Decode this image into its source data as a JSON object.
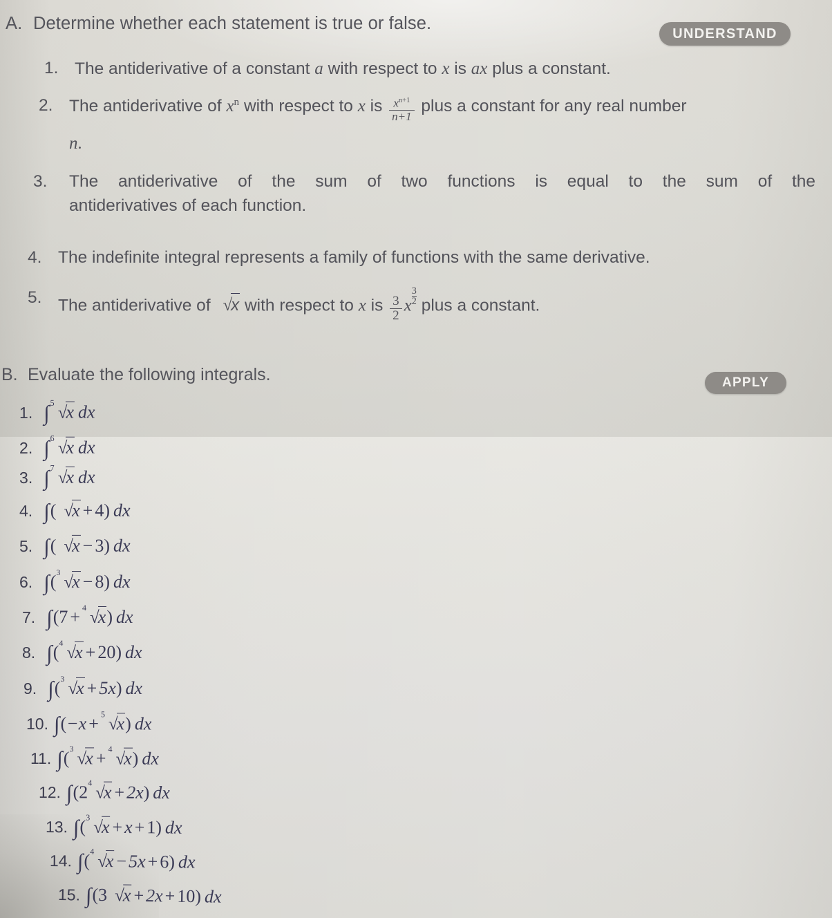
{
  "section_a": {
    "label": "A.",
    "title": "Determine whether each statement is true or false.",
    "badge": "UNDERSTAND",
    "badge_color": "#8e8b87",
    "items": [
      {
        "number": "1.",
        "text_parts": {
          "p1": "The antiderivative of a constant ",
          "var1": "a",
          "p2": " with respect to ",
          "var2": "x",
          "p3": " is ",
          "var3": "ax",
          "p4": " plus a constant."
        },
        "plain": "The antiderivative of a constant a with respect to x is ax plus a constant."
      },
      {
        "number": "2.",
        "text_parts": {
          "p1": "The antiderivative of ",
          "var1": "x",
          "exp1": "n",
          "p2": " with respect to ",
          "var2": "x",
          "p3": " is ",
          "frac_num": "x",
          "frac_num_exp": "n+1",
          "frac_den": "n+1",
          "p4": " plus a constant for any real number",
          "p5": "n",
          "p6": "."
        },
        "plain": "The antiderivative of x^n with respect to x is x^(n+1)/(n+1) plus a constant for any real number n."
      },
      {
        "number": "3.",
        "text_parts": {
          "p1": "The antiderivative of the sum of two functions is equal to the sum of the",
          "p2": "antiderivatives of each function."
        },
        "plain": "The antiderivative of the sum of two functions is equal to the sum of the antiderivatives of each function."
      },
      {
        "number": "4.",
        "text_parts": {
          "p1": "The indefinite integral represents a family of functions with the same derivative."
        },
        "plain": "The indefinite integral represents a family of functions with the same derivative."
      },
      {
        "number": "5.",
        "text_parts": {
          "p1": "The antiderivative of ",
          "rad": "x",
          "p2": " with respect to ",
          "var2": "x",
          "p3": " is ",
          "coef_num": "3",
          "coef_den": "2",
          "basevar": "x",
          "exp_num": "3",
          "exp_den": "2",
          "p4": " plus a constant."
        },
        "plain": "The antiderivative of sqrt(x) with respect to x is (3/2)x^(3/2) plus a constant."
      }
    ]
  },
  "section_b": {
    "label": "B.",
    "title": "Evaluate the following integrals.",
    "badge": "APPLY",
    "badge_color": "#8e8b87",
    "items": [
      {
        "number": "1.",
        "expr": "∫ ⁵√x dx",
        "terms": [
          {
            "type": "radical",
            "index": "5",
            "radicand": "x"
          }
        ]
      },
      {
        "number": "2.",
        "expr": "∫ ⁶√x dx",
        "terms": [
          {
            "type": "radical",
            "index": "6",
            "radicand": "x"
          }
        ]
      },
      {
        "number": "3.",
        "expr": "∫ ⁷√x dx",
        "terms": [
          {
            "type": "radical",
            "index": "7",
            "radicand": "x"
          }
        ]
      },
      {
        "number": "4.",
        "expr": "∫(√x + 4) dx",
        "terms": [
          {
            "type": "radical",
            "index": "",
            "radicand": "x"
          },
          {
            "type": "op",
            "value": "+"
          },
          {
            "type": "const",
            "value": "4"
          }
        ]
      },
      {
        "number": "5.",
        "expr": "∫(√x − 3) dx",
        "terms": [
          {
            "type": "radical",
            "index": "",
            "radicand": "x"
          },
          {
            "type": "op",
            "value": "−"
          },
          {
            "type": "const",
            "value": "3"
          }
        ]
      },
      {
        "number": "6.",
        "expr": "∫(³√x − 8) dx",
        "terms": [
          {
            "type": "radical",
            "index": "3",
            "radicand": "x"
          },
          {
            "type": "op",
            "value": "−"
          },
          {
            "type": "const",
            "value": "8"
          }
        ]
      },
      {
        "number": "7.",
        "expr": "∫(7 + ⁴√x) dx",
        "terms": [
          {
            "type": "const",
            "value": "7"
          },
          {
            "type": "op",
            "value": "+"
          },
          {
            "type": "radical",
            "index": "4",
            "radicand": "x"
          }
        ]
      },
      {
        "number": "8.",
        "expr": "∫(⁴√x + 20) dx",
        "terms": [
          {
            "type": "radical",
            "index": "4",
            "radicand": "x"
          },
          {
            "type": "op",
            "value": "+"
          },
          {
            "type": "const",
            "value": "20"
          }
        ]
      },
      {
        "number": "9.",
        "expr": "∫(³√x + 5x) dx",
        "terms": [
          {
            "type": "radical",
            "index": "3",
            "radicand": "x"
          },
          {
            "type": "op",
            "value": "+"
          },
          {
            "type": "term",
            "value": "5x"
          }
        ]
      },
      {
        "number": "10.",
        "expr": "∫(−x + ⁵√x) dx",
        "terms": [
          {
            "type": "term",
            "value": "−x"
          },
          {
            "type": "op",
            "value": "+"
          },
          {
            "type": "radical",
            "index": "5",
            "radicand": "x"
          }
        ]
      },
      {
        "number": "11.",
        "expr": "∫(³√x + ⁴√x) dx",
        "terms": [
          {
            "type": "radical",
            "index": "3",
            "radicand": "x"
          },
          {
            "type": "op",
            "value": "+"
          },
          {
            "type": "radical",
            "index": "4",
            "radicand": "x"
          }
        ]
      },
      {
        "number": "12.",
        "expr": "∫(2⁴√x + 2x) dx",
        "terms": [
          {
            "type": "coef_radical",
            "coef": "2",
            "index": "4",
            "radicand": "x"
          },
          {
            "type": "op",
            "value": "+"
          },
          {
            "type": "term",
            "value": "2x"
          }
        ]
      },
      {
        "number": "13.",
        "expr": "∫(³√x + x + 1) dx",
        "terms": [
          {
            "type": "radical",
            "index": "3",
            "radicand": "x"
          },
          {
            "type": "op",
            "value": "+"
          },
          {
            "type": "term",
            "value": "x"
          },
          {
            "type": "op",
            "value": "+"
          },
          {
            "type": "const",
            "value": "1"
          }
        ]
      },
      {
        "number": "14.",
        "expr": "∫(⁴√x − 5x + 6) dx",
        "terms": [
          {
            "type": "radical",
            "index": "4",
            "radicand": "x"
          },
          {
            "type": "op",
            "value": "−"
          },
          {
            "type": "term",
            "value": "5x"
          },
          {
            "type": "op",
            "value": "+"
          },
          {
            "type": "const",
            "value": "6"
          }
        ]
      },
      {
        "number": "15.",
        "expr": "∫(3√x + 2x + 10) dx",
        "terms": [
          {
            "type": "coef_radical",
            "coef": "3",
            "index": "",
            "radicand": "x"
          },
          {
            "type": "op",
            "value": "+"
          },
          {
            "type": "term",
            "value": "2x"
          },
          {
            "type": "op",
            "value": "+"
          },
          {
            "type": "const",
            "value": "10"
          }
        ]
      }
    ],
    "differential": "dx",
    "integral_symbol": "∫",
    "open_paren": "(",
    "close_paren": ")"
  }
}
